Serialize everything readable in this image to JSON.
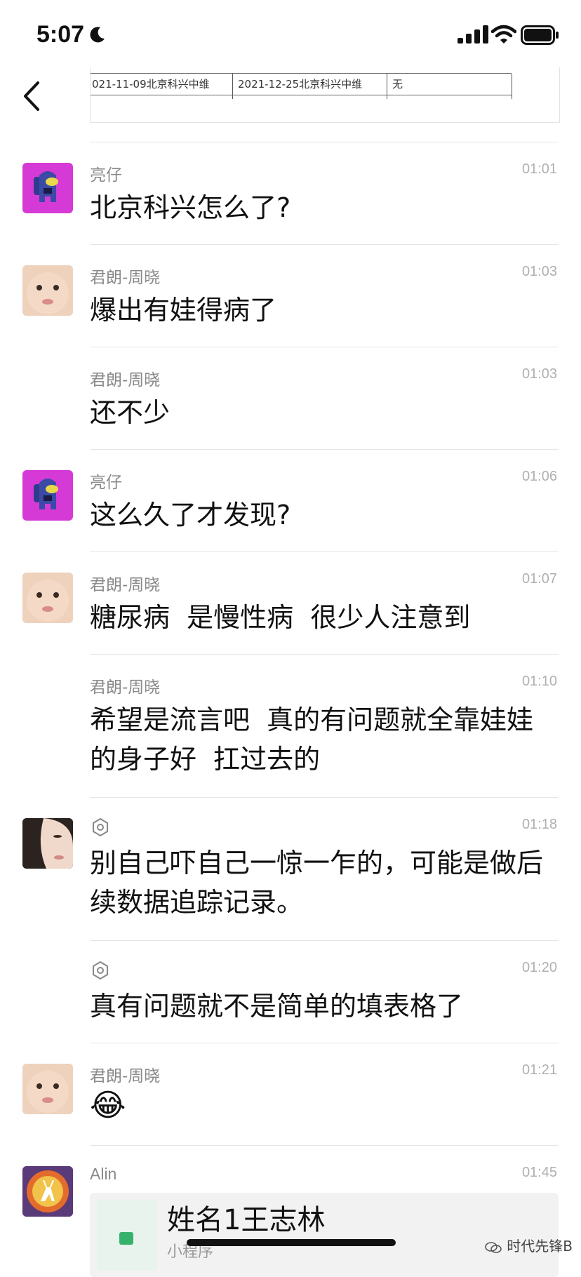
{
  "status_bar": {
    "time": "5:07"
  },
  "attachment_table": {
    "cells": [
      "021-11-09北京科兴中维",
      "2021-12-25北京科兴中维",
      "无"
    ]
  },
  "messages": [
    {
      "sender": "亮仔",
      "time": "01:01",
      "text": "北京科兴怎么了?"
    },
    {
      "sender": "君朗-周晓",
      "time": "01:03",
      "text": "爆出有娃得病了"
    },
    {
      "sender": "君朗-周晓",
      "time": "01:03",
      "text": "还不少"
    },
    {
      "sender": "亮仔",
      "time": "01:06",
      "text": "这么久了才发现?"
    },
    {
      "sender": "君朗-周晓",
      "time": "01:07",
      "text": "糖尿病  是慢性病  很少人注意到"
    },
    {
      "sender": "君朗-周晓",
      "time": "01:10",
      "text": "希望是流言吧  真的有问题就全靠娃娃的身子好  扛过去的"
    },
    {
      "sender": "",
      "time": "01:18",
      "text": "别自己吓自己一惊一乍的，可能是做后续数据追踪记录。"
    },
    {
      "sender": "",
      "time": "01:20",
      "text": "真有问题就不是简单的填表格了"
    },
    {
      "sender": "君朗-周晓",
      "time": "01:21",
      "text": "😂"
    },
    {
      "sender": "Alin",
      "time": "01:45",
      "text": ""
    }
  ],
  "mini_program_card": {
    "title": "姓名1王志林",
    "subtitle": "小程序"
  },
  "watermark": {
    "text": "时代先锋B"
  },
  "icons": {
    "back": "chevron-left-icon",
    "more": "more-dots-icon",
    "moon": "moon-icon",
    "signal": "signal-icon",
    "wifi": "wifi-icon",
    "battery": "battery-icon",
    "gear": "gear-icon",
    "mini_program": "spreadsheet-icon"
  },
  "colors": {
    "sender": "#8a8a8a",
    "time": "#b0b0b0",
    "text": "#111111",
    "divider": "#e5e5e5",
    "mini_program_green": "#37b26c"
  }
}
